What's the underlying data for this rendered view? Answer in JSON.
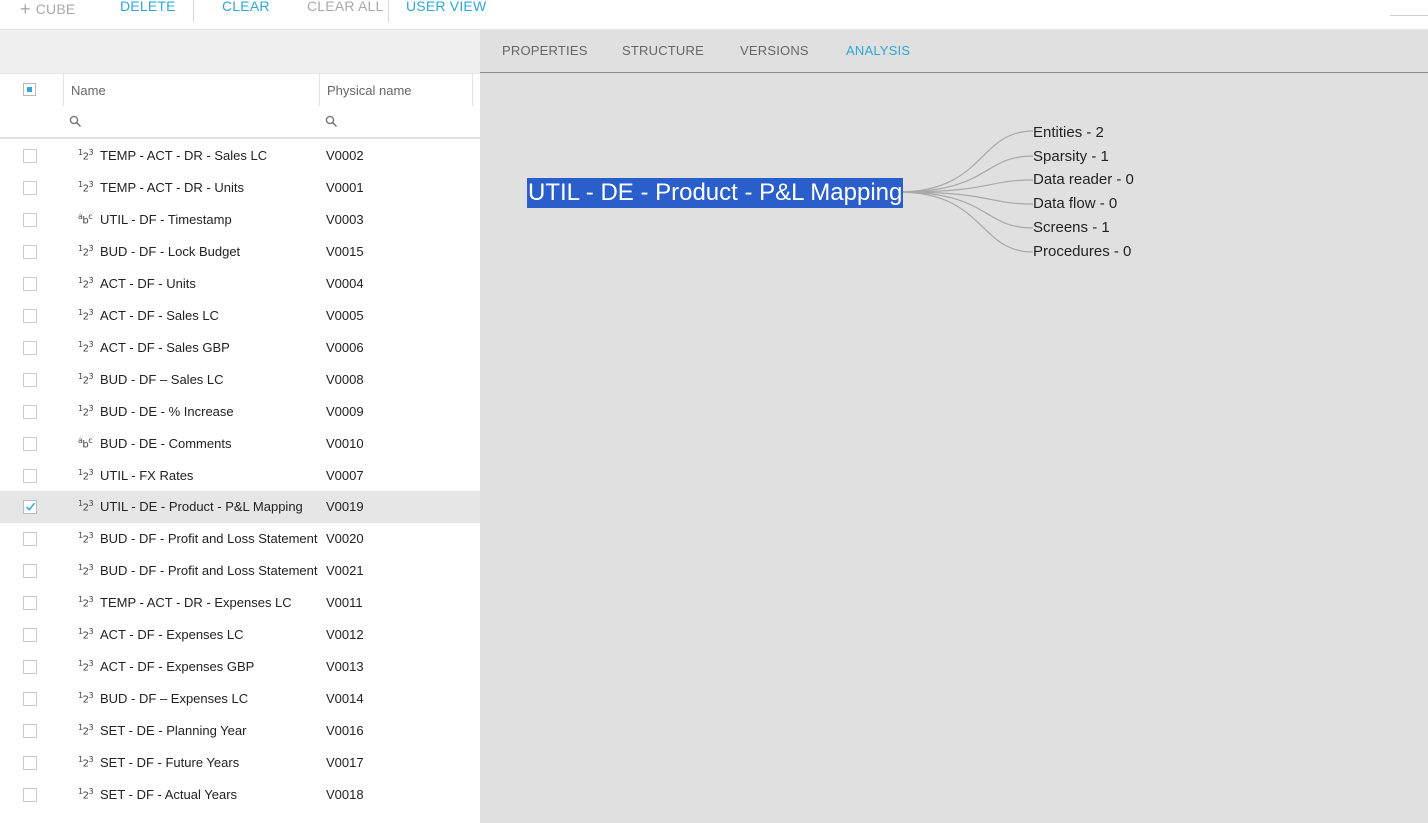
{
  "toolbar": {
    "cube_label": "CUBE",
    "delete_label": "DELETE",
    "clear_label": "CLEAR",
    "clear_all_label": "CLEAR ALL",
    "user_view_label": "USER VIEW"
  },
  "grid": {
    "columns": {
      "name": "Name",
      "physical_name": "Physical name"
    },
    "rows": [
      {
        "type": "numeric",
        "name": "TEMP - ACT - DR - Sales LC",
        "physical": "V0002",
        "checked": false
      },
      {
        "type": "numeric",
        "name": "TEMP - ACT - DR - Units",
        "physical": "V0001",
        "checked": false
      },
      {
        "type": "text",
        "name": "UTIL - DF - Timestamp",
        "physical": "V0003",
        "checked": false
      },
      {
        "type": "numeric",
        "name": "BUD - DF - Lock Budget",
        "physical": "V0015",
        "checked": false
      },
      {
        "type": "numeric",
        "name": "ACT - DF - Units",
        "physical": "V0004",
        "checked": false
      },
      {
        "type": "numeric",
        "name": "ACT - DF - Sales LC",
        "physical": "V0005",
        "checked": false
      },
      {
        "type": "numeric",
        "name": "ACT - DF - Sales GBP",
        "physical": "V0006",
        "checked": false
      },
      {
        "type": "numeric",
        "name": "BUD - DF – Sales LC",
        "physical": "V0008",
        "checked": false
      },
      {
        "type": "numeric",
        "name": "BUD - DE - % Increase",
        "physical": "V0009",
        "checked": false
      },
      {
        "type": "text",
        "name": "BUD - DE - Comments",
        "physical": "V0010",
        "checked": false
      },
      {
        "type": "numeric",
        "name": "UTIL - FX Rates",
        "physical": "V0007",
        "checked": false
      },
      {
        "type": "numeric",
        "name": "UTIL - DE - Product - P&L Mapping",
        "physical": "V0019",
        "checked": true
      },
      {
        "type": "numeric",
        "name": "BUD - DF - Profit and Loss Statement",
        "physical": "V0020",
        "checked": false
      },
      {
        "type": "numeric",
        "name": "BUD - DF - Profit and Loss Statement",
        "physical": "V0021",
        "checked": false
      },
      {
        "type": "numeric",
        "name": "TEMP - ACT - DR - Expenses LC",
        "physical": "V0011",
        "checked": false
      },
      {
        "type": "numeric",
        "name": "ACT - DF - Expenses LC",
        "physical": "V0012",
        "checked": false
      },
      {
        "type": "numeric",
        "name": "ACT - DF - Expenses GBP",
        "physical": "V0013",
        "checked": false
      },
      {
        "type": "numeric",
        "name": "BUD - DF – Expenses LC",
        "physical": "V0014",
        "checked": false
      },
      {
        "type": "numeric",
        "name": "SET - DE - Planning Year",
        "physical": "V0016",
        "checked": false
      },
      {
        "type": "numeric",
        "name": "SET - DF - Future Years",
        "physical": "V0017",
        "checked": false
      },
      {
        "type": "numeric",
        "name": "SET - DF - Actual Years",
        "physical": "V0018",
        "checked": false
      }
    ]
  },
  "panel": {
    "tabs": [
      {
        "label": "PROPERTIES",
        "active": false
      },
      {
        "label": "STRUCTURE",
        "active": false
      },
      {
        "label": "VERSIONS",
        "active": false
      },
      {
        "label": "ANALYSIS",
        "active": true
      }
    ],
    "analysis": {
      "root": "UTIL - DE - Product - P&L Mapping",
      "leaves": [
        "Entities - 2",
        "Sparsity - 1",
        "Data reader - 0",
        "Data flow - 0",
        "Screens - 1",
        "Procedures - 0"
      ]
    }
  },
  "colors": {
    "accent": "#2ea8d6",
    "selection": "#2a5fcb",
    "panel_bg": "#e0e0e0",
    "selected_row": "#e6e6e6"
  }
}
